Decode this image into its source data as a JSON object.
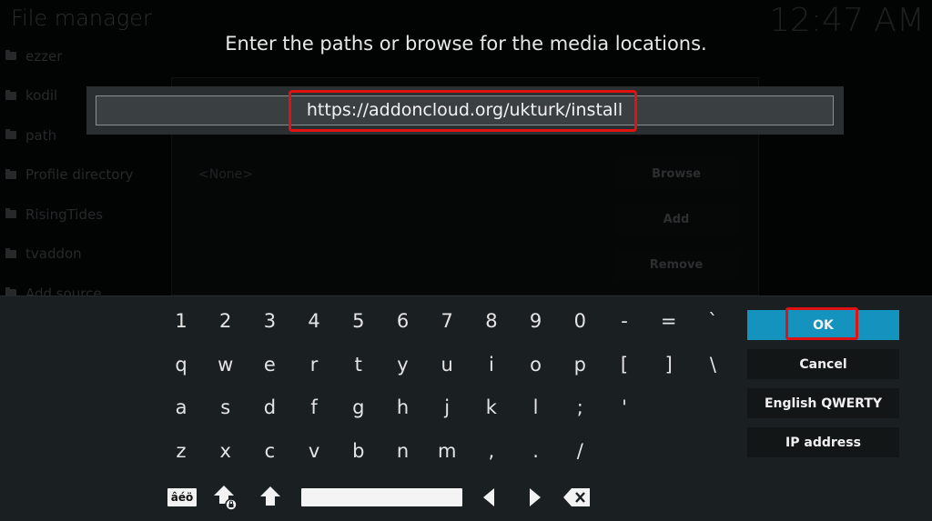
{
  "background": {
    "title": "File manager",
    "clock": "12:47 AM",
    "sources": [
      "ezzer",
      "kodil",
      "path",
      "Profile directory",
      "RisingTides",
      "tvaddon",
      "Add source"
    ],
    "panel": {
      "none_label": "<None>",
      "buttons": [
        "Browse",
        "Add",
        "Remove"
      ]
    }
  },
  "dialog": {
    "heading": "Enter the paths or browse for the media locations.",
    "input_value": "https://addoncloud.org/ukturk/install"
  },
  "keyboard": {
    "rows": [
      [
        "1",
        "2",
        "3",
        "4",
        "5",
        "6",
        "7",
        "8",
        "9",
        "0",
        "-",
        "=",
        "`"
      ],
      [
        "q",
        "w",
        "e",
        "r",
        "t",
        "y",
        "u",
        "i",
        "o",
        "p",
        "[",
        "]",
        "\\"
      ],
      [
        "a",
        "s",
        "d",
        "f",
        "g",
        "h",
        "j",
        "k",
        "l",
        ";",
        "'"
      ],
      [
        "z",
        "x",
        "c",
        "v",
        "b",
        "n",
        "m",
        ",",
        ".",
        "/"
      ]
    ],
    "accent_label": "âéö",
    "icons": [
      "caps-lock-icon",
      "shift-icon",
      "space-bar",
      "cursor-left-icon",
      "cursor-right-icon",
      "backspace-icon"
    ]
  },
  "side_buttons": {
    "ok": "OK",
    "cancel": "Cancel",
    "layout": "English QWERTY",
    "ip": "IP address"
  },
  "highlight_color": "#e01212",
  "accent_color": "#1593bf"
}
